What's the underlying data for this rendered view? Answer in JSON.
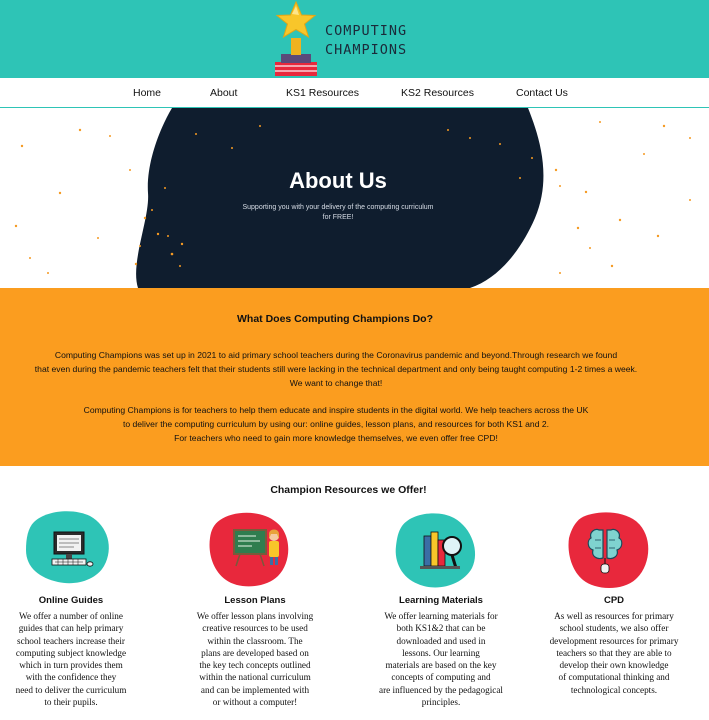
{
  "colors": {
    "header_teal": "#2ec4b6",
    "hero_navy": "#0f1d2e",
    "band_orange": "#fb9d1f",
    "accent_red": "#e8283c"
  },
  "logo": {
    "line1": "COMPUTING",
    "line2": "CHAMPIONS",
    "icon": "trophy-star-icon"
  },
  "nav": {
    "items": [
      {
        "label": "Home"
      },
      {
        "label": "About"
      },
      {
        "label": "KS1 Resources"
      },
      {
        "label": "KS2 Resources"
      },
      {
        "label": "Contact Us"
      }
    ]
  },
  "hero": {
    "title": "About Us",
    "subtitle_line1": "Supporting you with your delivery of the computing curriculum",
    "subtitle_line2": "for FREE!"
  },
  "about": {
    "heading": "What Does Computing Champions Do?",
    "p1_line1": "Computing Champions was set up in 2021 to aid primary school teachers during the Coronavirus pandemic and beyond.Through research we found",
    "p1_line2": "that even during the pandemic teachers felt that their students still were lacking in the technical department and only being taught computing 1-2 times a week.",
    "p1_line3": "We want to change that!",
    "p2_line1": "Computing Champions is for teachers to help them educate and inspire students in the digital world. We help teachers across the UK",
    "p2_line2": "to deliver the computing curriculum by using our: online guides, lesson plans, and resources for both KS1 and 2.",
    "p2_line3": "For teachers who need to gain more knowledge themselves, we even offer free CPD!"
  },
  "resources": {
    "heading": "Champion Resources we Offer!",
    "cards": [
      {
        "title": "Online Guides",
        "icon": "computer-icon",
        "lines": [
          "We offer a number of online",
          "guides that can help primary",
          "school teachers increase their",
          "computing subject knowledge",
          "which in turn provides them",
          "with the confidence they",
          "need to deliver the curriculum",
          "to their pupils."
        ]
      },
      {
        "title": "Lesson Plans",
        "icon": "teacher-board-icon",
        "lines": [
          "We offer lesson plans involving",
          "creative resources to be used",
          "within the classroom. The",
          "plans are developed based on",
          "the key tech concepts outlined",
          "within the national curriculum",
          "and can be implemented with",
          "or without a computer!"
        ]
      },
      {
        "title": "Learning Materials",
        "icon": "books-magnifier-icon",
        "lines": [
          "We offer learning materials for",
          "both KS1&2 that can be",
          "downloaded and used in",
          "lessons. Our learning",
          "materials are based on the key",
          "concepts of computing and",
          "are influenced by the pedagogical",
          "principles."
        ]
      },
      {
        "title": "CPD",
        "icon": "brain-circuit-icon",
        "lines": [
          "As well as resources for primary",
          "school students, we also offer",
          "development resources for primary",
          "teachers so that they are able to",
          "develop their own knowledge",
          "of computational thinking and",
          "technological concepts."
        ]
      }
    ]
  }
}
